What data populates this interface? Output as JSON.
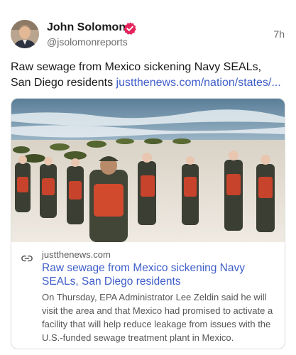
{
  "post": {
    "author_name": "John Solomon",
    "handle": "@jsolomonreports",
    "timestamp": "7h",
    "text": "Raw sewage from Mexico sickening Navy SEALs, San Diego residents",
    "link_text": "justthenews.com/nation/states/..."
  },
  "link_card": {
    "domain": "justthenews.com",
    "title": "Raw sewage from Mexico sickening Navy SEALs, San Diego residents",
    "description": "On Thursday, EPA Administrator Lee Zeldin said he will visit the area and that Mexico had promised to activate a facility that will help reduce leakage from issues with the U.S.-funded sewage treatment plant in Mexico."
  },
  "icons": {
    "verified": "verified-badge-icon",
    "link": "link-icon"
  },
  "colors": {
    "accent": "#E4245A",
    "link": "#3F5EC9",
    "secondary_text": "#6B6B6B"
  }
}
